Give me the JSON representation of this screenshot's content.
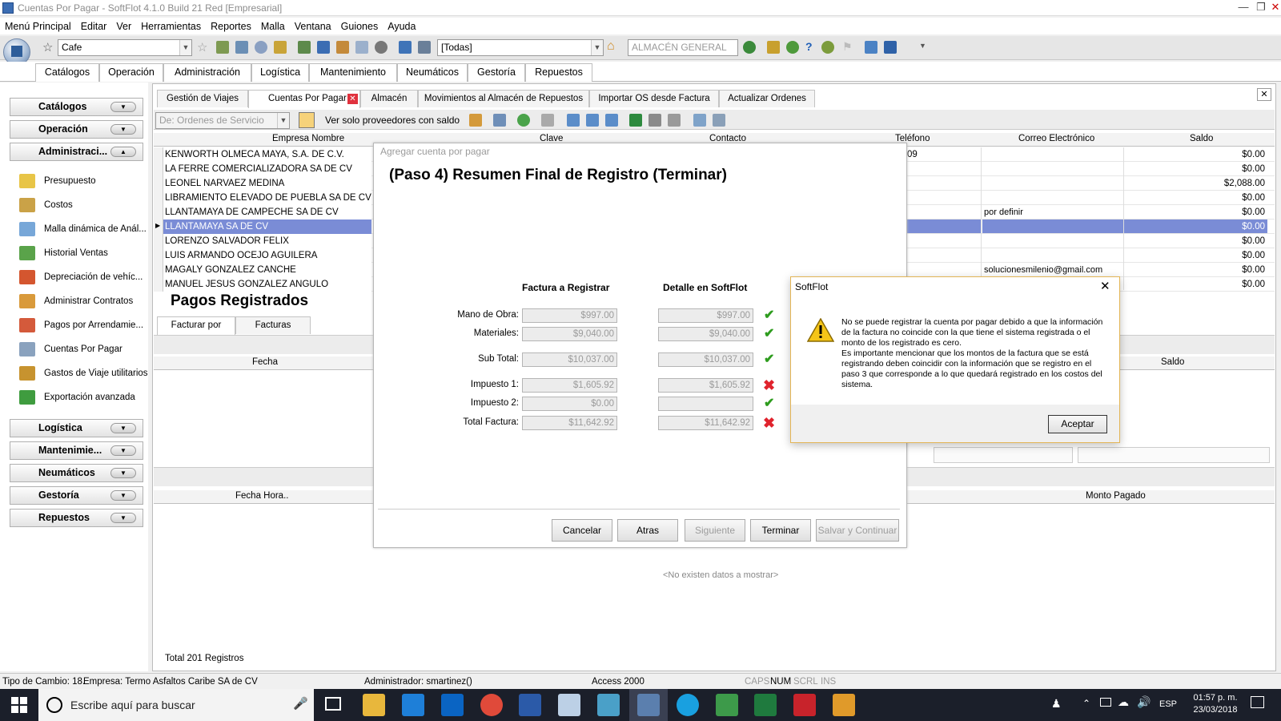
{
  "window": {
    "title": "Cuentas Por Pagar - SoftFlot 4.1.0 Build 21 Red  [Empresarial]"
  },
  "menu": [
    "Menú Principal",
    "Editar",
    "Ver",
    "Herramientas",
    "Reportes",
    "Malla",
    "Ventana",
    "Guiones",
    "Ayuda"
  ],
  "toolbar": {
    "company": "Cafe",
    "branch": "[Todas]",
    "warehouse": "ALMACÉN GENERAL"
  },
  "ribbon_tabs": [
    "Catálogos",
    "Operación",
    "Administración",
    "Logística",
    "Mantenimiento",
    "Neumáticos",
    "Gestoría",
    "Repuestos"
  ],
  "nav": {
    "groups_top": [
      "Catálogos",
      "Operación",
      "Administraci..."
    ],
    "items": [
      "Presupuesto",
      "Costos",
      "Malla dinámica de Anál...",
      "Historial Ventas",
      "Depreciación de vehíc...",
      "Administrar Contratos",
      "Pagos por Arrendamie...",
      "Cuentas Por Pagar",
      "Gastos de Viaje utilitarios",
      "Exportación avanzada"
    ],
    "groups_bottom": [
      "Logística",
      "Mantenimie...",
      "Neumáticos",
      "Gestoría",
      "Repuestos"
    ]
  },
  "doc_tabs": [
    "Gestión de Viajes",
    "Cuentas Por Pagar",
    "Almacén",
    "Movimientos al Almacén de Repuestos",
    "Importar OS desde Factura",
    "Actualizar Ordenes"
  ],
  "subtoolbar": {
    "from_label": "De:",
    "from_placeholder": "Ordenes de Servicio",
    "only_balance": "Ver solo proveedores con saldo"
  },
  "grid": {
    "columns": {
      "empresa": "Empresa Nombre",
      "clave": "Clave",
      "contacto": "Contacto",
      "telefono": "Teléfono",
      "correo": "Correo Electrónico",
      "saldo": "Saldo"
    },
    "rows": [
      {
        "empresa": "KENWORTH OLMECA MAYA, S.A. DE C.V.",
        "telefono": "09",
        "correo": "",
        "saldo": "$0.00"
      },
      {
        "empresa": "LA FERRE COMERCIALIZADORA SA DE CV",
        "telefono": "",
        "correo": "",
        "saldo": "$0.00"
      },
      {
        "empresa": "LEONEL NARVAEZ MEDINA",
        "telefono": "",
        "correo": "",
        "saldo": "$2,088.00"
      },
      {
        "empresa": "LIBRAMIENTO ELEVADO DE PUEBLA SA DE CV",
        "telefono": "",
        "correo": "",
        "saldo": "$0.00"
      },
      {
        "empresa": "LLANTAMAYA DE CAMPECHE SA DE CV",
        "telefono": "",
        "correo": "por definir",
        "saldo": "$0.00"
      },
      {
        "empresa": "LLANTAMAYA SA DE CV",
        "telefono": "",
        "correo": "",
        "saldo": "$0.00"
      },
      {
        "empresa": "LORENZO SALVADOR FELIX",
        "telefono": "",
        "correo": "",
        "saldo": "$0.00"
      },
      {
        "empresa": "LUIS ARMANDO OCEJO AGUILERA",
        "telefono": "",
        "correo": "",
        "saldo": "$0.00"
      },
      {
        "empresa": "MAGALY GONZALEZ CANCHE",
        "telefono": "",
        "correo": "solucionesmilenio@gmail.com",
        "saldo": "$0.00"
      },
      {
        "empresa": "MANUEL JESUS GONZALEZ ANGULO",
        "telefono": "",
        "correo": "",
        "saldo": "$0.00"
      }
    ],
    "selected_index": 5
  },
  "pagos": {
    "title": "Pagos Registrados",
    "tabs": [
      "Facturar por Pagar",
      "Facturas Pagadas"
    ],
    "col_fecha": "Fecha",
    "col_saldo": "Saldo",
    "col_fecha_hora": "Fecha Hora..",
    "col_monto": "Monto Pagado",
    "empty": "<No existen datos a mostrar>",
    "total": "Total 201 Registros"
  },
  "wizard": {
    "title": "Agregar cuenta por pagar",
    "heading": "(Paso 4)  Resumen Final de Registro (Terminar)",
    "col_invoice": "Factura a Registrar",
    "col_detail": "Detalle en SoftFlot",
    "fields": [
      {
        "label": "Mano de Obra:",
        "invoice": "$997.00",
        "detail": "$997.00",
        "match": true
      },
      {
        "label": "Materiales:",
        "invoice": "$9,040.00",
        "detail": "$9,040.00",
        "match": true
      },
      {
        "label": "Sub Total:",
        "invoice": "$10,037.00",
        "detail": "$10,037.00",
        "match": true
      },
      {
        "label": "Impuesto 1:",
        "invoice": "$1,605.92",
        "detail": "$1,605.92",
        "match": false
      },
      {
        "label": "Impuesto 2:",
        "invoice": "$0.00",
        "detail": "",
        "match": true
      },
      {
        "label": "Total Factura:",
        "invoice": "$11,642.92",
        "detail": "$11,642.92",
        "match": false
      }
    ],
    "buttons": {
      "cancel": "Cancelar",
      "back": "Atras",
      "next": "Siguiente",
      "finish": "Terminar",
      "save_continue": "Salvar y Continuar"
    }
  },
  "alert": {
    "title": "SoftFlot",
    "message": "No se puede registrar la cuenta por pagar debido a que la información de la factura no coincide con la que tiene el sistema registrada o el monto de los registrado es cero.\nEs importante mencionar que los montos de la factura que se está registrando deben coincidir con la información que se registro en el paso 3 que corresponde a lo que quedará registrado en los costos del sistema.",
    "ok": "Aceptar"
  },
  "status": {
    "tipo_cambio": "Tipo de Cambio: 18.",
    "empresa": "Empresa: Termo Asfaltos Caribe SA de CV",
    "admin": "Administrador: smartinez()",
    "db": "Access 2000",
    "caps": "CAPS",
    "num": "NUM",
    "scrl": "SCRL",
    "ins": "INS"
  },
  "taskbar": {
    "search_placeholder": "Escribe aquí para buscar",
    "lang": "ESP",
    "time": "01:57 p. m.",
    "date": "23/03/2018"
  },
  "colors": {
    "selection": "#7a8cd6",
    "check": "#2e9c1e",
    "cross": "#e0232d",
    "taskbar": "#1b1f2a",
    "alert_border": "#e3b556"
  }
}
